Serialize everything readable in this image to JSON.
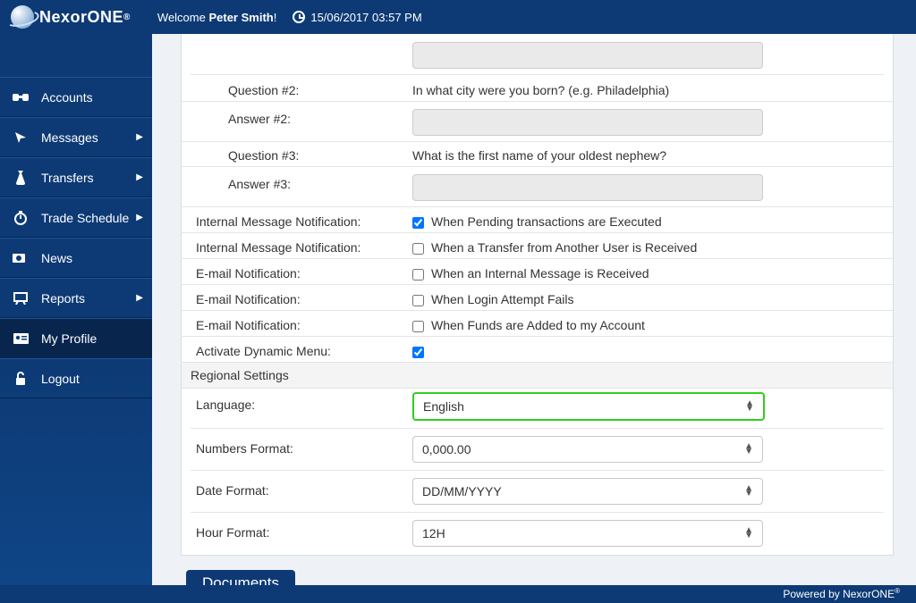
{
  "brand": {
    "name": "NexorONE",
    "trademark": "®"
  },
  "header": {
    "welcome_prefix": "Welcome ",
    "user_name": "Peter Smith",
    "welcome_suffix": "!",
    "timestamp": "15/06/2017 03:57 PM"
  },
  "nav": {
    "accounts": "Accounts",
    "messages": "Messages",
    "transfers": "Transfers",
    "trade_schedule": "Trade Schedule",
    "news": "News",
    "reports": "Reports",
    "my_profile": "My Profile",
    "logout": "Logout"
  },
  "form": {
    "q2_label": "Question #2:",
    "q2_value": "In what city were you born? (e.g. Philadelphia)",
    "a2_label": "Answer #2:",
    "q3_label": "Question #3:",
    "q3_value": "What is the first name of your oldest nephew?",
    "a3_label": "Answer #3:",
    "imn_label": "Internal Message Notification:",
    "imn1_text": "When Pending transactions are Executed",
    "imn2_text": "When a Transfer from Another User is Received",
    "email_label": "E-mail Notification:",
    "email1_text": "When an Internal Message is Received",
    "email2_text": "When Login Attempt Fails",
    "email3_text": "When Funds are Added to my Account",
    "dyn_menu_label": "Activate Dynamic Menu:",
    "regional_header": "Regional Settings",
    "language_label": "Language:",
    "language_value": "English",
    "numbers_label": "Numbers Format:",
    "numbers_value": "0,000.00",
    "date_label": "Date Format:",
    "date_value": "DD/MM/YYYY",
    "hour_label": "Hour Format:",
    "hour_value": "12H"
  },
  "checks": {
    "imn1": true,
    "imn2": false,
    "email1": false,
    "email2": false,
    "email3": false,
    "dyn_menu": true
  },
  "tabs": {
    "documents": "Documents"
  },
  "footer": {
    "text": "Powered by NexorONE",
    "trademark": "®"
  }
}
